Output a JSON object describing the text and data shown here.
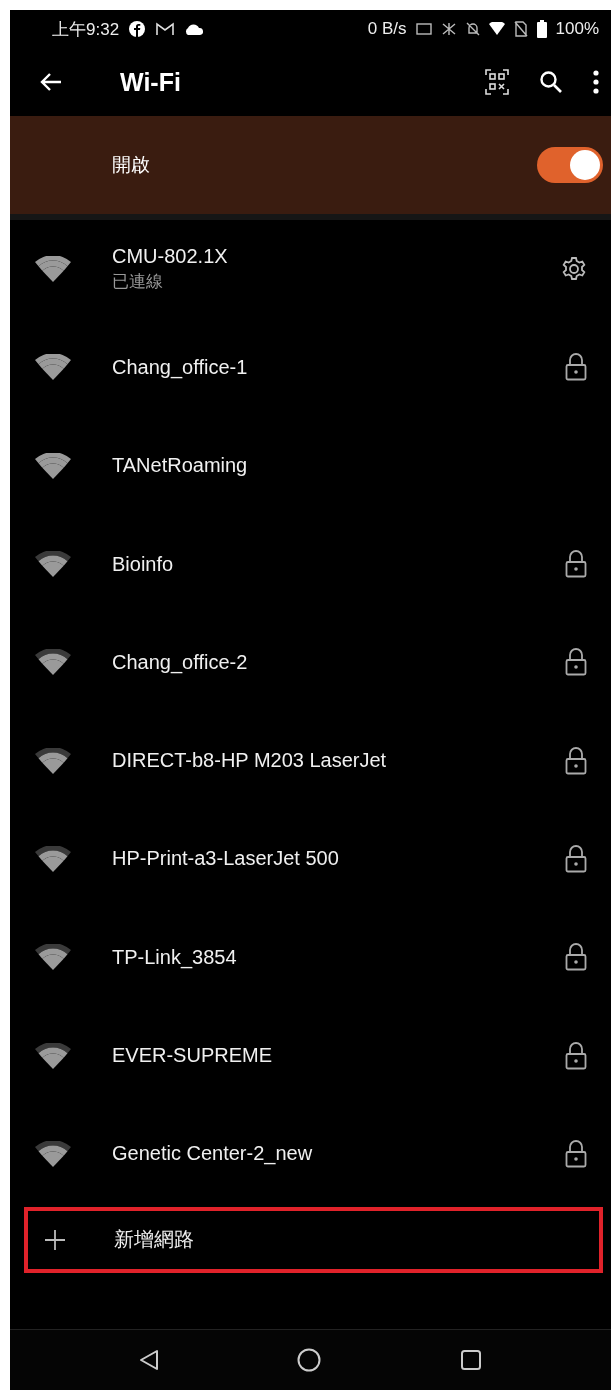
{
  "status_bar": {
    "time": "上午9:32",
    "speed": "0 B/s",
    "battery": "100%"
  },
  "app_bar": {
    "title": "Wi-Fi"
  },
  "master_switch": {
    "label": "開啟",
    "on": true
  },
  "networks": [
    {
      "kind": "connected",
      "name": "CMU-802.1X",
      "status": "已連線",
      "strong": true
    },
    {
      "kind": "locked",
      "name": "Chang_office-1",
      "strong": true
    },
    {
      "kind": "open",
      "name": "TANetRoaming",
      "strong": true
    },
    {
      "kind": "locked",
      "name": "Bioinfo",
      "strong": false
    },
    {
      "kind": "locked",
      "name": "Chang_office-2",
      "strong": false
    },
    {
      "kind": "locked",
      "name": "DIRECT-b8-HP M203 LaserJet",
      "strong": false
    },
    {
      "kind": "locked",
      "name": "HP-Print-a3-LaserJet 500",
      "strong": false
    },
    {
      "kind": "locked",
      "name": "TP-Link_3854",
      "strong": false
    },
    {
      "kind": "locked",
      "name": "EVER-SUPREME",
      "strong": false
    },
    {
      "kind": "locked",
      "name": "Genetic Center-2_new",
      "strong": false
    }
  ],
  "add_network": {
    "label": "新增網路",
    "highlighted": true
  }
}
